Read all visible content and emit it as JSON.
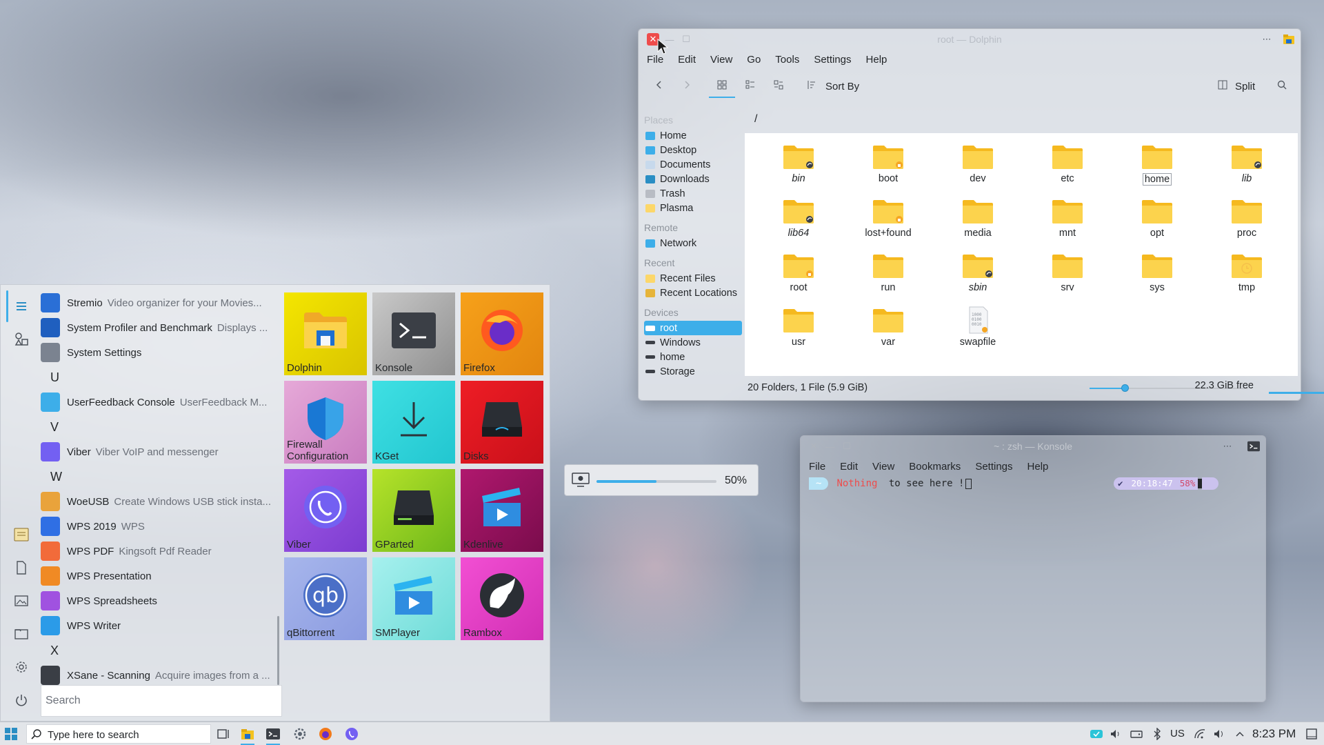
{
  "dolphin": {
    "title": "root — Dolphin",
    "menu": [
      "File",
      "Edit",
      "View",
      "Go",
      "Tools",
      "Settings",
      "Help"
    ],
    "toolbar": {
      "sort_label": "Sort By",
      "split_label": "Split"
    },
    "breadcrumb": "/",
    "places": {
      "heading": "Places",
      "items": [
        "Home",
        "Desktop",
        "Documents",
        "Downloads",
        "Trash",
        "Plasma"
      ]
    },
    "remote": {
      "heading": "Remote",
      "items": [
        "Network"
      ]
    },
    "recent": {
      "heading": "Recent",
      "items": [
        "Recent Files",
        "Recent Locations"
      ]
    },
    "devices": {
      "heading": "Devices",
      "items": [
        "root",
        "Windows",
        "home",
        "Storage"
      ]
    },
    "files": [
      {
        "name": "bin",
        "italic": true,
        "badge": "link"
      },
      {
        "name": "boot",
        "italic": false,
        "badge": "lock"
      },
      {
        "name": "dev",
        "italic": false,
        "badge": ""
      },
      {
        "name": "etc",
        "italic": false,
        "badge": ""
      },
      {
        "name": "home",
        "italic": false,
        "badge": "",
        "selected": true
      },
      {
        "name": "lib",
        "italic": true,
        "badge": "link"
      },
      {
        "name": "lib64",
        "italic": true,
        "badge": "link"
      },
      {
        "name": "lost+found",
        "italic": false,
        "badge": "lock"
      },
      {
        "name": "media",
        "italic": false,
        "badge": ""
      },
      {
        "name": "mnt",
        "italic": false,
        "badge": ""
      },
      {
        "name": "opt",
        "italic": false,
        "badge": ""
      },
      {
        "name": "proc",
        "italic": false,
        "badge": ""
      },
      {
        "name": "root",
        "italic": false,
        "badge": "lock"
      },
      {
        "name": "run",
        "italic": false,
        "badge": ""
      },
      {
        "name": "sbin",
        "italic": true,
        "badge": "link"
      },
      {
        "name": "srv",
        "italic": false,
        "badge": ""
      },
      {
        "name": "sys",
        "italic": false,
        "badge": ""
      },
      {
        "name": "tmp",
        "italic": false,
        "badge": "clock"
      },
      {
        "name": "usr",
        "italic": false,
        "badge": ""
      },
      {
        "name": "var",
        "italic": false,
        "badge": ""
      },
      {
        "name": "swapfile",
        "italic": false,
        "badge": "file"
      }
    ],
    "status": "20 Folders, 1 File (5.9 GiB)",
    "zoom_level": 0.22,
    "free_space": "22.3 GiB free",
    "used_fraction": 0.4
  },
  "konsole": {
    "title": "~ : zsh — Konsole",
    "menu": [
      "File",
      "Edit",
      "View",
      "Bookmarks",
      "Settings",
      "Help"
    ],
    "prompt_dir": "~",
    "line_red": "Nothing",
    "line_rest": " to see here !",
    "right_check": "✔",
    "right_time": "20:18:47",
    "right_battery": "58%"
  },
  "osd": {
    "value_label": "50%",
    "level": 0.5
  },
  "startmenu": {
    "apps": [
      {
        "type": "app",
        "name": "Stremio",
        "desc": "Video organizer for your Movies...",
        "icon": "stremio-icon",
        "color": "#2a6fd6"
      },
      {
        "type": "app",
        "name": "System Profiler and Benchmark",
        "desc": "Displays ...",
        "icon": "monitor-icon",
        "color": "#1f5fbf"
      },
      {
        "type": "app",
        "name": "System Settings",
        "desc": "",
        "icon": "gear-icon",
        "color": "#7b8390"
      },
      {
        "type": "letter",
        "name": "U"
      },
      {
        "type": "app",
        "name": "UserFeedback Console",
        "desc": "UserFeedback M...",
        "icon": "magnifier-icon",
        "color": "#3daee9"
      },
      {
        "type": "letter",
        "name": "V"
      },
      {
        "type": "app",
        "name": "Viber",
        "desc": "Viber VoIP and messenger",
        "icon": "viber-icon",
        "color": "#7360f2"
      },
      {
        "type": "letter",
        "name": "W"
      },
      {
        "type": "app",
        "name": "WoeUSB",
        "desc": "Create Windows USB stick insta...",
        "icon": "windows-flag-icon",
        "color": "#e9a33b"
      },
      {
        "type": "app",
        "name": "WPS 2019",
        "desc": "WPS",
        "icon": "wps-icon",
        "color": "#2f6fe4"
      },
      {
        "type": "app",
        "name": "WPS PDF",
        "desc": "Kingsoft Pdf Reader",
        "icon": "wps-pdf-icon",
        "color": "#f26b3a"
      },
      {
        "type": "app",
        "name": "WPS Presentation",
        "desc": "",
        "icon": "wps-presentation-icon",
        "color": "#f08a24"
      },
      {
        "type": "app",
        "name": "WPS Spreadsheets",
        "desc": "",
        "icon": "wps-spreadsheets-icon",
        "color": "#a052e0"
      },
      {
        "type": "app",
        "name": "WPS Writer",
        "desc": "",
        "icon": "wps-writer-icon",
        "color": "#2b9be8"
      },
      {
        "type": "letter",
        "name": "X"
      },
      {
        "type": "app",
        "name": "XSane - Scanning",
        "desc": "Acquire images from a ...",
        "icon": "scanner-icon",
        "color": "#3a3e45"
      }
    ],
    "search_placeholder": "Search",
    "tiles": [
      {
        "label": "Dolphin",
        "icon": "dolphin-icon",
        "bg": "linear-gradient(135deg,#f4e600,#d9c400)"
      },
      {
        "label": "Konsole",
        "icon": "konsole-icon",
        "bg": "linear-gradient(135deg,#c9c9c9,#8f8f8f)"
      },
      {
        "label": "Firefox",
        "icon": "firefox-icon",
        "bg": "linear-gradient(135deg,#f7a11a,#e2860f)"
      },
      {
        "label": "Firewall Configuration",
        "icon": "shield-icon",
        "bg": "linear-gradient(135deg,#e6a9d8,#c97cc0)"
      },
      {
        "label": "KGet",
        "icon": "download-icon",
        "bg": "linear-gradient(135deg,#3fe0e3,#22c6d0)"
      },
      {
        "label": "Disks",
        "icon": "disk-icon",
        "bg": "linear-gradient(135deg,#ee1d25,#c9101a)"
      },
      {
        "label": "Viber",
        "icon": "viber-icon",
        "bg": "linear-gradient(135deg,#a45be8,#7c3cd0)"
      },
      {
        "label": "GParted",
        "icon": "gparted-icon",
        "bg": "linear-gradient(135deg,#b6e32a,#6fb81a)"
      },
      {
        "label": "Kdenlive",
        "icon": "clapper-icon",
        "bg": "linear-gradient(135deg,#b0186e,#7a0c4c)"
      },
      {
        "label": "qBittorrent",
        "icon": "qbittorrent-icon",
        "bg": "linear-gradient(135deg,#a7b6ec,#8b9be0)"
      },
      {
        "label": "SMPlayer",
        "icon": "smplayer-icon",
        "bg": "linear-gradient(135deg,#a6f0ee,#6fdcd8)"
      },
      {
        "label": "Rambox",
        "icon": "rambox-icon",
        "bg": "linear-gradient(135deg,#f24fd3,#d12fb4)"
      }
    ]
  },
  "taskbar": {
    "search_placeholder": "Type here to search",
    "keyboard_layout": "US",
    "clock": "8:23 PM"
  },
  "colors": {
    "accent": "#3daee9",
    "folder": "#fcc735",
    "close": "#ee4c4c"
  }
}
